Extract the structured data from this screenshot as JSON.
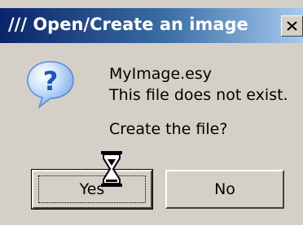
{
  "window": {
    "title": "/// Open/Create an image",
    "close_glyph": "X"
  },
  "dialog": {
    "icon": "question-icon",
    "file_name": "MyImage.esy",
    "message": "This file does not exist.",
    "question": "Create the file?"
  },
  "buttons": {
    "yes_label": "Yes",
    "no_label": "No"
  },
  "cursor": {
    "icon": "hourglass-icon"
  },
  "colors": {
    "title_start": "#0a246a",
    "title_end": "#a6caf0",
    "face": "#d4d0c8",
    "icon_blue": "#2a73d6"
  }
}
